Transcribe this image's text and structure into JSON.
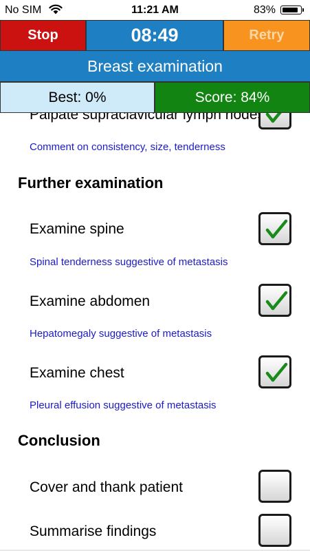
{
  "status_bar": {
    "carrier": "No SIM",
    "time": "11:21 AM",
    "battery_percent": "83%",
    "battery_level": 0.83
  },
  "toolbar": {
    "stop_label": "Stop",
    "timer": "08:49",
    "retry_label": "Retry"
  },
  "title": "Breast examination",
  "scores": {
    "best": "Best: 0%",
    "score": "Score: 84%"
  },
  "items": {
    "palpate_supraclavicular": {
      "label": "Palpate supraclavicular lymph nodes",
      "comment": "Comment on consistency, size, tenderness",
      "checked": true
    },
    "further_heading": "Further examination",
    "examine_spine": {
      "label": "Examine spine",
      "comment": "Spinal tenderness suggestive of metastasis",
      "checked": true
    },
    "examine_abdomen": {
      "label": "Examine abdomen",
      "comment": "Hepatomegaly suggestive of metastasis",
      "checked": true
    },
    "examine_chest": {
      "label": "Examine chest",
      "comment": "Pleural effusion suggestive of metastasis",
      "checked": true
    },
    "conclusion_heading": "Conclusion",
    "cover_thank": {
      "label": "Cover and thank patient",
      "checked": false
    },
    "summarise": {
      "label": "Summarise findings",
      "checked": false
    }
  },
  "colors": {
    "stop": "#cc1111",
    "blue": "#1f7fc3",
    "retry": "#f7931e",
    "best_bg": "#cfeaf8",
    "score_bg": "#128412",
    "comment_text": "#1a1acc",
    "check": "#1a8a1a"
  },
  "icons": [
    "wifi-icon",
    "battery-icon",
    "checkmark-icon"
  ]
}
